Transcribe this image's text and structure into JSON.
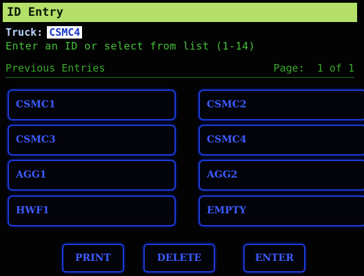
{
  "title": "ID Entry",
  "truck": {
    "label": "Truck:",
    "value": "CSMC4"
  },
  "instruction": "Enter an ID or select from list (1-14)",
  "previous": {
    "label": "Previous Entries",
    "page_label": "Page:",
    "page_current": "1",
    "page_of": "of",
    "page_total": "1"
  },
  "entries": [
    "CSMC1",
    "CSMC2",
    "CSMC3",
    "CSMC4",
    "AGG1",
    "AGG2",
    "HWF1",
    "EMPTY"
  ],
  "actions": {
    "print": "PRINT",
    "delete": "DELETE",
    "enter": "ENTER"
  },
  "colors": {
    "title_bar": "#b4e06a",
    "text_green": "#46c23a",
    "button_blue": "#1b3bd8",
    "button_text": "#3d5cff"
  }
}
